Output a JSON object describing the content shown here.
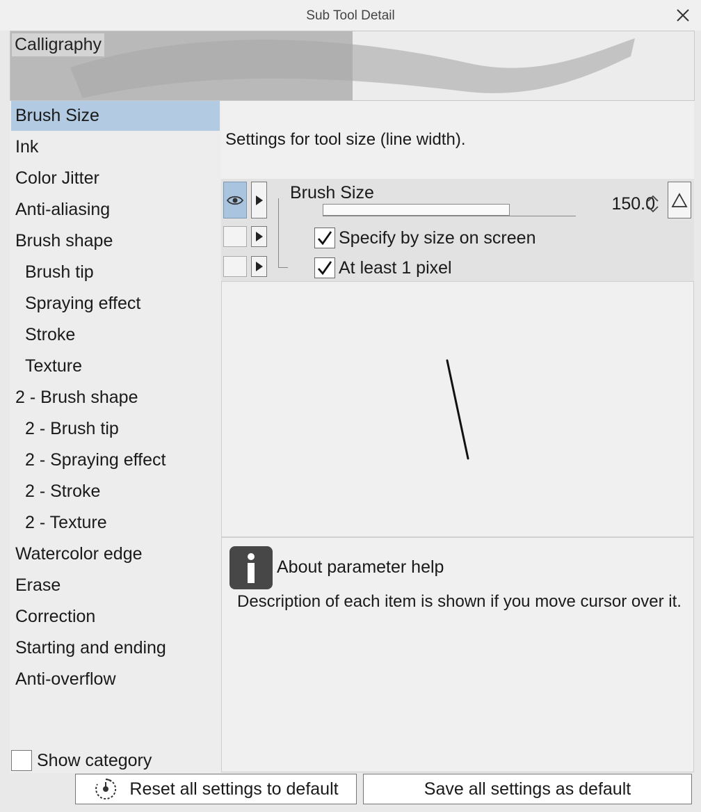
{
  "window": {
    "title": "Sub Tool Detail"
  },
  "preview": {
    "label": "Calligraphy"
  },
  "sidebar": {
    "items": [
      {
        "label": "Brush Size",
        "indent": false,
        "selected": true
      },
      {
        "label": "Ink",
        "indent": false
      },
      {
        "label": "Color Jitter",
        "indent": false
      },
      {
        "label": "Anti-aliasing",
        "indent": false
      },
      {
        "label": "Brush shape",
        "indent": false
      },
      {
        "label": "Brush tip",
        "indent": true
      },
      {
        "label": "Spraying effect",
        "indent": true
      },
      {
        "label": "Stroke",
        "indent": true
      },
      {
        "label": "Texture",
        "indent": true
      },
      {
        "label": "2 - Brush shape",
        "indent": false
      },
      {
        "label": "2 - Brush tip",
        "indent": true
      },
      {
        "label": "2 - Spraying effect",
        "indent": true
      },
      {
        "label": "2 - Stroke",
        "indent": true
      },
      {
        "label": "2 - Texture",
        "indent": true
      },
      {
        "label": "Watercolor edge",
        "indent": false
      },
      {
        "label": "Erase",
        "indent": false
      },
      {
        "label": "Correction",
        "indent": false
      },
      {
        "label": "Starting and ending",
        "indent": false
      },
      {
        "label": "Anti-overflow",
        "indent": false
      }
    ],
    "show_category": {
      "label": "Show category",
      "checked": false
    }
  },
  "description": "Settings for tool size (line width).",
  "params": {
    "brush_size": {
      "label": "Brush Size",
      "value": "150.0",
      "slider_fraction": 0.74
    },
    "specify_by_screen": {
      "label": "Specify by size on screen",
      "checked": true
    },
    "at_least_1px": {
      "label": "At least 1 pixel",
      "checked": true
    }
  },
  "help": {
    "title": "About parameter help",
    "text": "Description of each item is shown if you move cursor over it."
  },
  "footer": {
    "reset_label": "Reset all settings to default",
    "save_label": "Save all settings as default"
  },
  "icons": [
    "close-icon",
    "eye-icon",
    "play-arrow-icon",
    "spin-icon",
    "triangle-icon",
    "checkmark-icon",
    "info-icon",
    "reset-dial-icon"
  ],
  "colors": {
    "selected": "#b3cbe2",
    "eye_active": "#a9c4df",
    "info_icon": "#474747"
  }
}
